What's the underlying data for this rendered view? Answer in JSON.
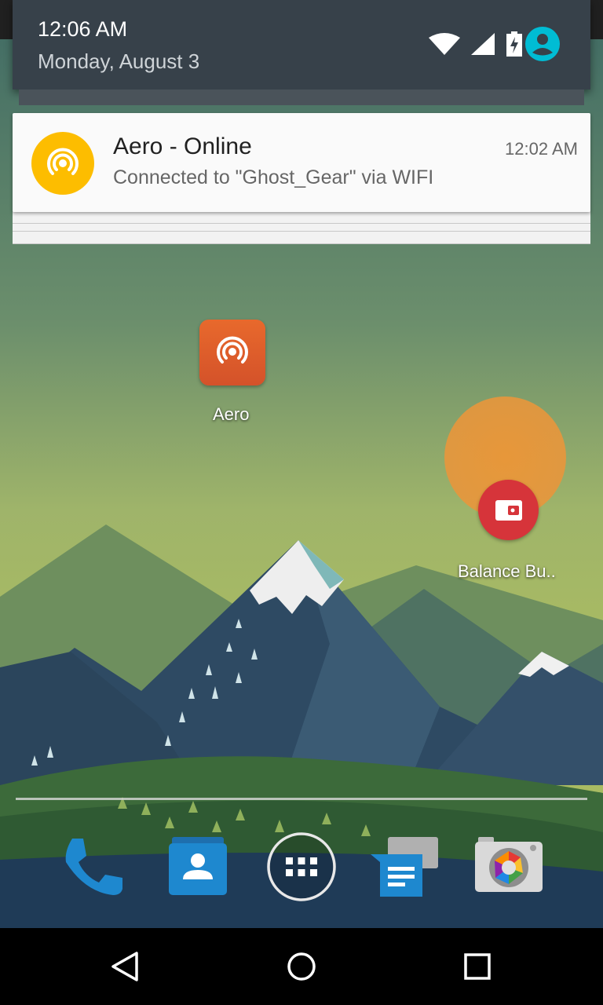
{
  "status": {
    "time": "12:06 AM",
    "date": "Monday, August 3"
  },
  "notification": {
    "title": "Aero - Online",
    "text": "Connected to \"Ghost_Gear\" via WIFI",
    "time": "12:02 AM",
    "icon": "broadcast-icon",
    "icon_color": "#fdbd00"
  },
  "home": {
    "apps": [
      {
        "label": "Aero",
        "icon": "aero-broadcast-icon"
      },
      {
        "label": "Balance Bu..",
        "icon": "wallet-icon"
      }
    ]
  },
  "dock": [
    "phone-icon",
    "contacts-icon",
    "app-drawer-icon",
    "messenger-icon",
    "camera-icon"
  ],
  "nav": [
    "back-icon",
    "home-icon",
    "recents-icon"
  ],
  "colors": {
    "shade": "#37414a",
    "accent": "#00bcd4",
    "balance": "#d6343a"
  }
}
